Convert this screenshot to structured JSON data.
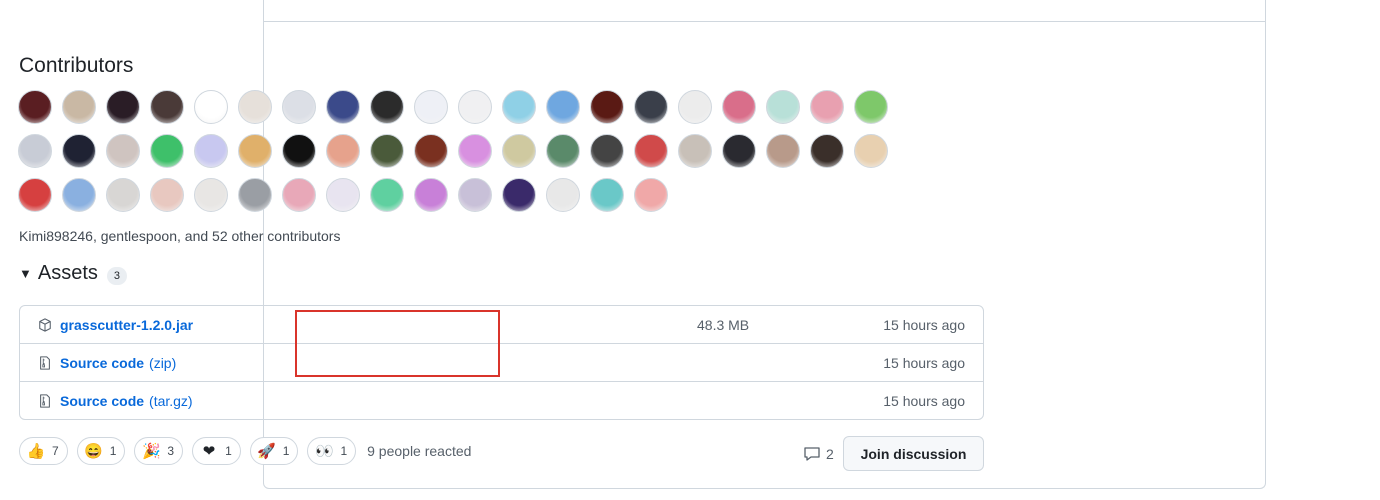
{
  "contributors": {
    "title": "Contributors",
    "summary": "Kimi898246, gentlespoon, and 52 other contributors",
    "avatar_colors": [
      "#5a1e22",
      "#c9b8a4",
      "#2a1d26",
      "#4a3a38",
      "#ffffff",
      "#e6e0da",
      "#dcdfe6",
      "#3b4a8a",
      "#2b2b2b",
      "#eef0f6",
      "#f0f0f2",
      "#8fd0e6",
      "#6fa7e0",
      "#5a1a14",
      "#3a3f4a",
      "#ececec",
      "#d96e8a",
      "#b8e0d8",
      "#e8a0b0",
      "#7ec86a",
      "#c8ccd6",
      "#1f2233",
      "#cfc4c0",
      "#3ec06a",
      "#c8c8f0",
      "#e0b06a",
      "#111111",
      "#e6a28c",
      "#4a5a3a",
      "#7a3020",
      "#d890e0",
      "#cfc9a0",
      "#5a8a6a",
      "#444444",
      "#d04a4a",
      "#c8c0b8",
      "#2a2a30",
      "#b89a8a",
      "#3a2f2a",
      "#e8d0b0",
      "#d64040",
      "#8ab0e0",
      "#d8d6d4",
      "#e8c8c0",
      "#e8e6e4",
      "#9a9ea4",
      "#e8a8b8",
      "#e8e4f0",
      "#5fd0a0",
      "#c880d8",
      "#c8c0d8",
      "#3a2a6a",
      "#e8e8e8",
      "#6ac8c8",
      "#f0a8a8"
    ]
  },
  "assets": {
    "title": "Assets",
    "count": "3",
    "rows": [
      {
        "name": "grasscutter-1.2.0.jar",
        "suffix": "",
        "size": "48.3 MB",
        "date": "15 hours ago",
        "icon": "package-icon"
      },
      {
        "name": "Source code",
        "suffix": "(zip)",
        "size": "",
        "date": "15 hours ago",
        "icon": "file-zip-icon"
      },
      {
        "name": "Source code",
        "suffix": "(tar.gz)",
        "size": "",
        "date": "15 hours ago",
        "icon": "file-zip-icon"
      }
    ]
  },
  "reactions": {
    "items": [
      {
        "emoji": "👍",
        "name": "thumbs-up-icon",
        "count": "7"
      },
      {
        "emoji": "😄",
        "name": "laugh-icon",
        "count": "1"
      },
      {
        "emoji": "🎉",
        "name": "hooray-icon",
        "count": "3"
      },
      {
        "emoji": "❤",
        "name": "heart-icon",
        "count": "1"
      },
      {
        "emoji": "🚀",
        "name": "rocket-icon",
        "count": "1"
      },
      {
        "emoji": "👀",
        "name": "eyes-icon",
        "count": "1"
      }
    ],
    "summary": "9 people reacted"
  },
  "discussion": {
    "comment_count": "2",
    "join_label": "Join discussion"
  },
  "colors": {
    "link": "#0969da",
    "highlight": "#d9342b",
    "border": "#d0d7de"
  }
}
